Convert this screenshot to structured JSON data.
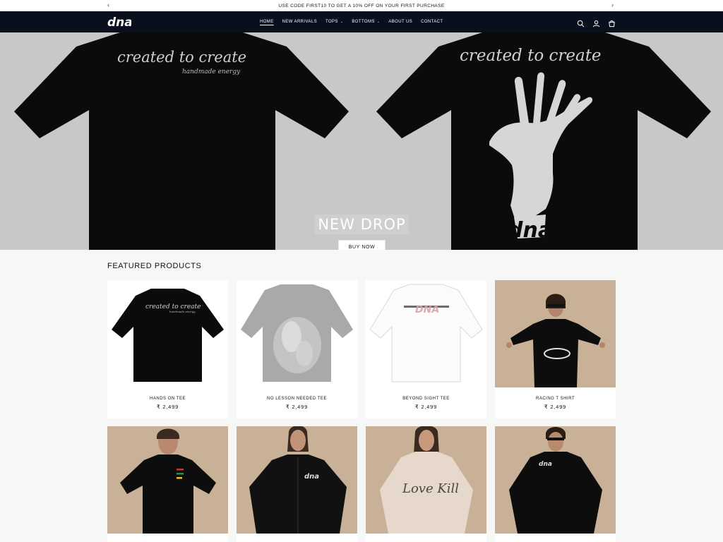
{
  "announcement": {
    "text": "USE CODE FIRST10 TO GET A 10% OFF ON YOUR FIRST PURCHASE",
    "prev": "‹",
    "next": "›"
  },
  "header": {
    "logo_text": "dna",
    "nav": [
      {
        "label": "HOME",
        "active": true
      },
      {
        "label": "NEW ARRIVALS"
      },
      {
        "label": "TOPS",
        "dropdown": true
      },
      {
        "label": "BOTTOMS",
        "dropdown": true
      },
      {
        "label": "ABOUT US"
      },
      {
        "label": "CONTACT"
      }
    ],
    "chevron": "⌄",
    "icons": [
      "search-icon",
      "account-icon",
      "cart-icon"
    ]
  },
  "hero": {
    "title": "NEW DROP",
    "button": "BUY NOW",
    "shirt_text": "created to create",
    "shirt_subtext": "handmade energy",
    "shirt_logo": "dna"
  },
  "featured": {
    "heading": "FEATURED PRODUCTS",
    "products": [
      {
        "name": "HANDS ON TEE",
        "price": "₹ 2,499"
      },
      {
        "name": "NO LESSON NEEDED TEE",
        "price": "₹ 2,499"
      },
      {
        "name": "BEYOND SIGHT TEE",
        "price": "₹ 2,499"
      },
      {
        "name": "RACING T SHIRT",
        "price": "₹ 2,499"
      }
    ]
  },
  "colors": {
    "header_bg": "#0a0f1e",
    "hero_bg": "#c8c8c8",
    "photo_bg": "#c4aa90"
  }
}
